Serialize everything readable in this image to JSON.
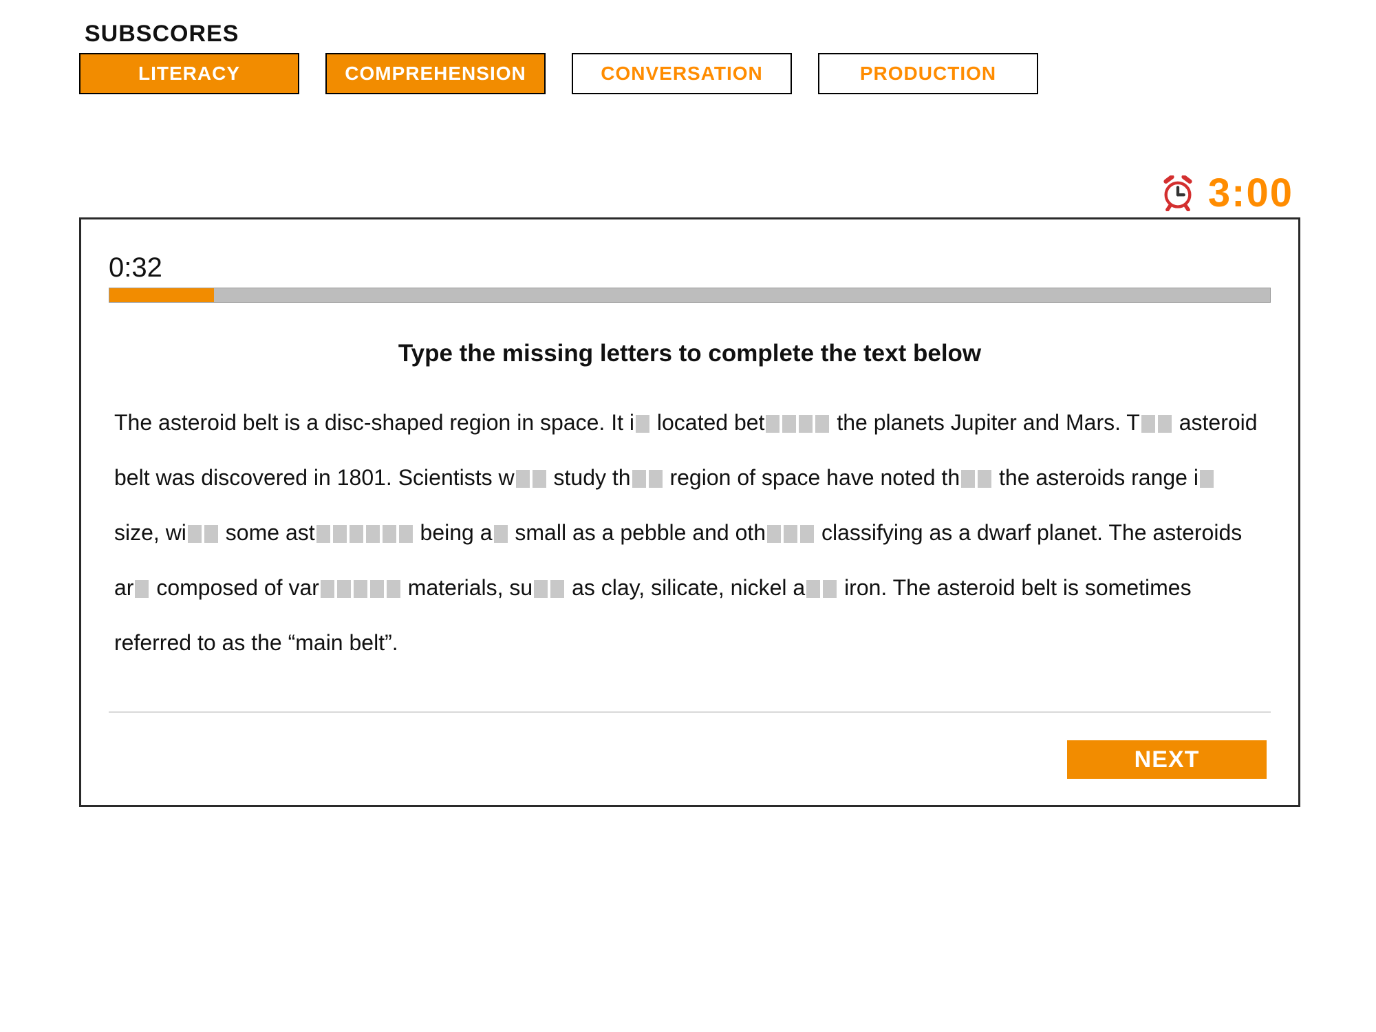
{
  "header": {
    "title": "SUBSCORES",
    "tabs": [
      {
        "label": "LITERACY",
        "style": "filled"
      },
      {
        "label": "COMPREHENSION",
        "style": "filled"
      },
      {
        "label": "CONVERSATION",
        "style": "outlined"
      },
      {
        "label": "PRODUCTION",
        "style": "outlined"
      }
    ]
  },
  "timer": {
    "icon_name": "alarm-clock-icon",
    "remaining": "3:00"
  },
  "panel": {
    "elapsed": "0:32",
    "progress_percent": 9,
    "instruction": "Type the missing letters to complete the text below",
    "exercise_segments": [
      {
        "t": "The asteroid belt is a disc-shaped region in space. It i"
      },
      {
        "blank": 1
      },
      {
        "t": " located bet"
      },
      {
        "blank": 4
      },
      {
        "t": " the planets Jupiter and Mars. T"
      },
      {
        "blank": 2
      },
      {
        "t": " asteroid belt was discovered in 1801. Scientists w"
      },
      {
        "blank": 2
      },
      {
        "t": " study th"
      },
      {
        "blank": 2
      },
      {
        "t": " region of space have noted th"
      },
      {
        "blank": 2
      },
      {
        "t": " the asteroids range i"
      },
      {
        "blank": 1
      },
      {
        "t": " size, wi"
      },
      {
        "blank": 2
      },
      {
        "t": " some ast"
      },
      {
        "blank": 6
      },
      {
        "t": " being a"
      },
      {
        "blank": 1
      },
      {
        "t": " small as a pebble and oth"
      },
      {
        "blank": 3
      },
      {
        "t": " classifying as a dwarf planet. The asteroids ar"
      },
      {
        "blank": 1
      },
      {
        "t": " composed of var"
      },
      {
        "blank": 5
      },
      {
        "t": " materials, su"
      },
      {
        "blank": 2
      },
      {
        "t": " as clay, silicate, nickel a"
      },
      {
        "blank": 2
      },
      {
        "t": " iron. The asteroid belt is sometimes referred to as the “main belt”."
      }
    ],
    "next_label": "NEXT"
  }
}
